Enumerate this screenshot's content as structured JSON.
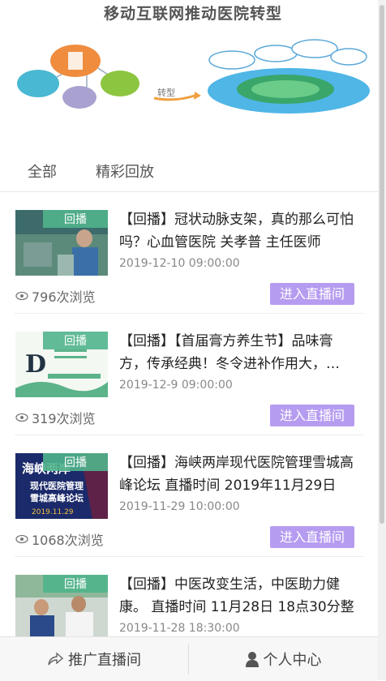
{
  "banner": {
    "title": "移动互联网推动医院转型"
  },
  "tabs": [
    {
      "label": "全部"
    },
    {
      "label": "精彩回放"
    }
  ],
  "items": [
    {
      "badge": "回播",
      "title": "【回播】冠状动脉支架，真的那么可怕吗？心血管医院 关孝普 主任医师",
      "date": "2019-12-10 09:00:00",
      "views": "796次浏览",
      "action": "进入直播间",
      "thumb_icon": "hospital-staff-photo"
    },
    {
      "badge": "回播",
      "title": "【回播】【首届膏方养生节】品味膏方，传承经典！冬令进补作用大，…",
      "date": "2019-12-9 09:00:00",
      "views": "319次浏览",
      "action": "进入直播间",
      "thumb_icon": "festival-poster"
    },
    {
      "badge": "回播",
      "title": "【回播】海峡两岸现代医院管理雪城高峰论坛 直播时间 2019年11月29日",
      "date": "2019-11-29 10:00:00",
      "views": "1068次浏览",
      "action": "进入直播间",
      "thumb_icon": "forum-poster",
      "thumb_text": [
        "海峡两岸",
        "现代医院管理",
        "雪城高峰论坛",
        "2019.11.29"
      ]
    },
    {
      "badge": "回播",
      "title": "【回播】中医改变生活，中医助力健康。 直播时间 11月28日 18点30分整",
      "date": "2019-11-28 18:30:00",
      "views": "",
      "action": "",
      "thumb_icon": "doctor-photo"
    }
  ],
  "bottom_nav": {
    "promote": "推广直播间",
    "profile": "个人中心"
  },
  "colors": {
    "accent": "#b69cf0",
    "badge": "#50b48c"
  }
}
